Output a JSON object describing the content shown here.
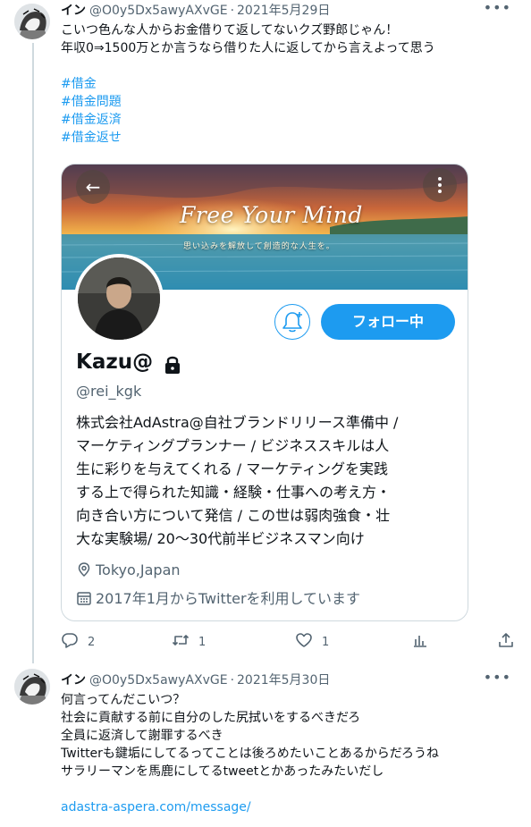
{
  "tweet1": {
    "author_name": "イン",
    "author_handle": "@O0y5Dx5awyAXvGE",
    "separator": "·",
    "date": "2021年5月29日",
    "text_lines": [
      "こいつ色んな人からお金借りて返してないクズ野郎じゃん！",
      "年収0⇒1500万とか言うなら借りた人に返してから言えよって思う"
    ],
    "hashtags": [
      "#借金",
      "#借金問題",
      "#借金返済",
      "#借金返せ"
    ],
    "more_icon": "more-icon",
    "card": {
      "banner_title": "Free Your Mind",
      "banner_subtitle": "思い込みを解放して創造的な人生を。",
      "follow_label": "フォロー中",
      "profile_name": "Kazu@",
      "profile_handle": "@rei_kgk",
      "bio_lines": [
        "株式会社AdAstra@自社ブランドリリース準備中 /",
        "マーケティングプランナー / ビジネススキルは人",
        "生に彩りを与えてくれる / マーケティングを実践",
        "する上で得られた知識・経験・仕事への考え方・",
        "向き合い方について発信 / この世は弱肉強食・壮",
        "大な実験場/ 20〜30代前半ビジネスマン向け"
      ],
      "location": "Tokyo,Japan",
      "joined": "2017年1月からTwitterを利用しています"
    },
    "actions": {
      "replies": "2",
      "retweets": "1",
      "likes": "1"
    }
  },
  "tweet2": {
    "author_name": "イン",
    "author_handle": "@O0y5Dx5awyAXvGE",
    "separator": "·",
    "date": "2021年5月30日",
    "text_lines": [
      "何言ってんだこいつ？",
      "社会に貢献する前に自分のした尻拭いをするべきだろ",
      "全員に返済して謝罪するべき",
      "Twitterも鍵垢にしてるってことは後ろめたいことあるからだろうね",
      "サラリーマンを馬鹿にしてるtweetとかあったみたいだし"
    ],
    "link": "adastra-aspera.com/message/"
  },
  "colors": {
    "accent": "#1d9bf0",
    "secondary_text": "#536471",
    "border": "#cfd9de"
  }
}
